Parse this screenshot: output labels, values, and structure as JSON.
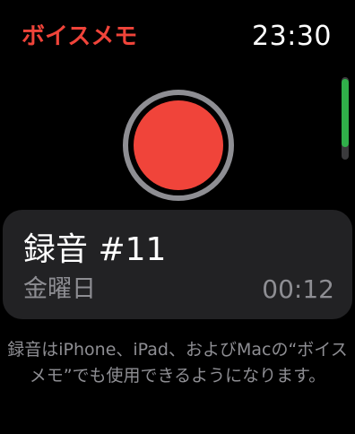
{
  "app": {
    "title": "ボイスメモ",
    "title_color": "#f0443a"
  },
  "status": {
    "time": "23:30"
  },
  "scroll_indicator": {
    "thumb_color": "#30b04a",
    "position": 0.15
  },
  "record_button": {
    "icon": "record-icon",
    "color": "#f0443a",
    "ring_color": "#8e8e93"
  },
  "recordings": [
    {
      "title": "録音 #11",
      "day": "金曜日",
      "duration": "00:12"
    }
  ],
  "footer": {
    "text": "録音はiPhone、iPad、およびMacの“ボイスメモ”でも使用できるようになります。"
  }
}
